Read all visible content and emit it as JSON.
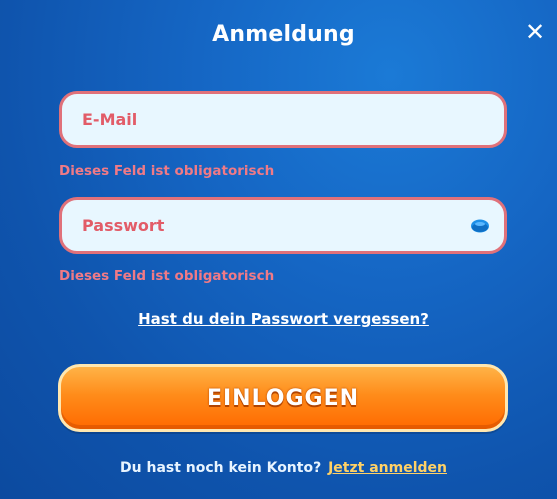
{
  "modal": {
    "title": "Anmeldung",
    "close_symbol": "✕"
  },
  "email": {
    "placeholder": "E-Mail",
    "value": "",
    "error": "Dieses Feld ist obligatorisch"
  },
  "password": {
    "placeholder": "Passwort",
    "value": "",
    "error": "Dieses Feld ist obligatorisch",
    "toggle_icon": "eye-icon"
  },
  "forgot_password": "Hast du dein Passwort vergessen?",
  "login_button": "EINLOGGEN",
  "register": {
    "prompt": "Du hast noch kein Konto?",
    "link": "Jetzt anmelden"
  },
  "colors": {
    "background": "#1566c4",
    "field_border": "#e0717a",
    "error_text": "#f07a86",
    "button": "#ff8c1a",
    "register_link": "#ffd166"
  }
}
